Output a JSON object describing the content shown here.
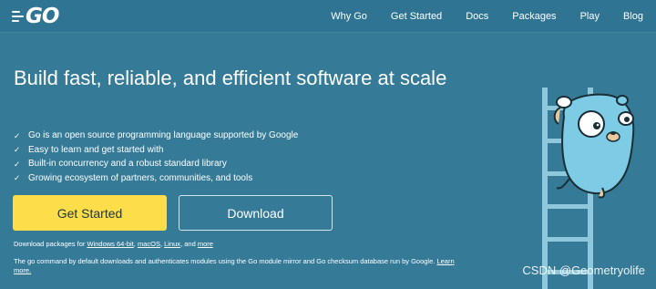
{
  "nav": {
    "logo_text": "GO",
    "items": [
      "Why Go",
      "Get Started",
      "Docs",
      "Packages",
      "Play",
      "Blog"
    ]
  },
  "hero": {
    "title": "Build fast, reliable, and efficient software at scale",
    "features": [
      "Go is an open source programming language supported by Google",
      "Easy to learn and get started with",
      "Built-in concurrency and a robust standard library",
      "Growing ecosystem of partners, communities, and tools"
    ],
    "primary_button": "Get Started",
    "secondary_button": "Download",
    "download_prefix": "Download packages for",
    "download_links": [
      "Windows 64-bit",
      "macOS",
      "Linux"
    ],
    "download_sep": ", ",
    "download_and": ", and",
    "download_more": "more",
    "notice_text": "The go command by default downloads and authenticates modules using the Go module mirror and Go checksum database run by Google.",
    "notice_link": "Learn more."
  },
  "watermark": "CSDN @Geometryolife",
  "colors": {
    "background": "#357b98",
    "primary_button": "#fddd4a",
    "gopher": "#7ecbe6"
  }
}
